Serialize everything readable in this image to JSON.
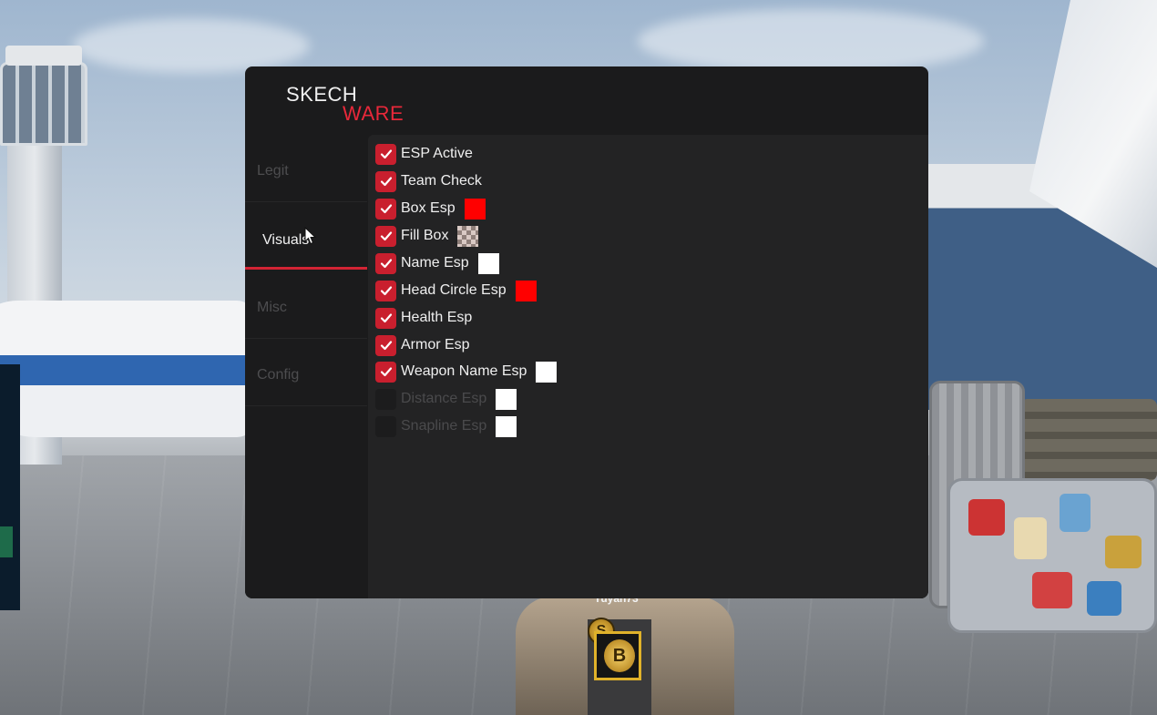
{
  "app": {
    "logo_line1": "SKECH",
    "logo_line2": "WARE",
    "accent_color": "#d32434",
    "logo_accent_color": "#e8283a"
  },
  "sidebar": {
    "tabs": [
      {
        "label": "Legit",
        "active": false
      },
      {
        "label": "Visuals",
        "active": true
      },
      {
        "label": "Misc",
        "active": false
      },
      {
        "label": "Config",
        "active": false
      }
    ]
  },
  "visuals": {
    "options": [
      {
        "label": "ESP Active",
        "checked": true,
        "color": null
      },
      {
        "label": "Team Check",
        "checked": true,
        "color": null
      },
      {
        "label": "Box Esp",
        "checked": true,
        "color": "#ff0000"
      },
      {
        "label": "Fill Box",
        "checked": true,
        "color": "transparent"
      },
      {
        "label": "Name Esp",
        "checked": true,
        "color": "#ffffff"
      },
      {
        "label": "Head Circle Esp",
        "checked": true,
        "color": "#ff0000"
      },
      {
        "label": "Health Esp",
        "checked": true,
        "color": null
      },
      {
        "label": "Armor Esp",
        "checked": true,
        "color": null
      },
      {
        "label": "Weapon Name Esp",
        "checked": true,
        "color": "#ffffff"
      },
      {
        "label": "Distance Esp",
        "checked": false,
        "color": "#ffffff"
      },
      {
        "label": "Snapline Esp",
        "checked": false,
        "color": "#ffffff"
      }
    ]
  },
  "scene": {
    "player_name": "Yuyan73",
    "coin_small_label": "S",
    "coin_card_label": "B"
  }
}
